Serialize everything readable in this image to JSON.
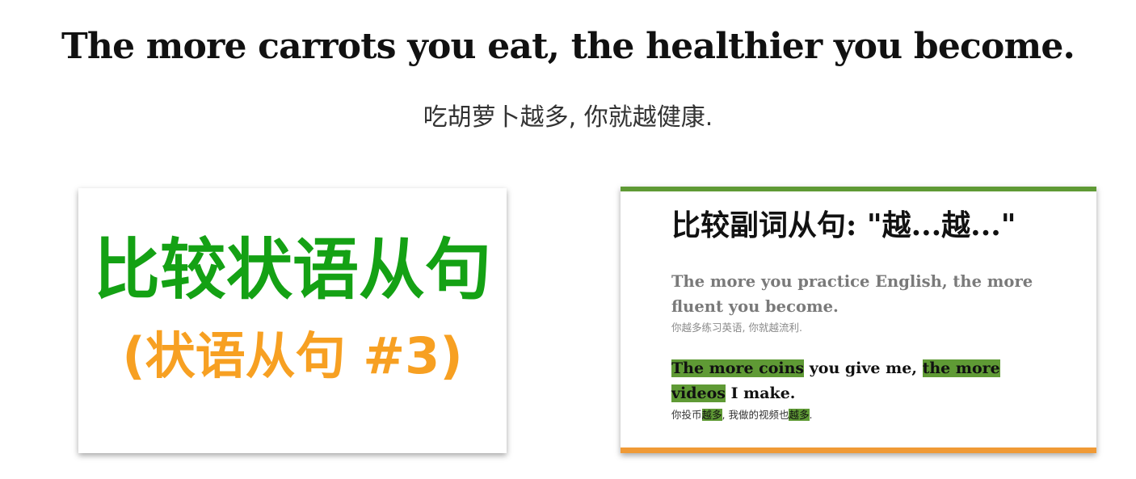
{
  "headline": {
    "en": "The more carrots you eat, the healthier you become.",
    "zh": "吃胡萝卜越多, 你就越健康."
  },
  "left_card": {
    "title": "比较状语从句",
    "subtitle": "(状语从句 #3)",
    "title_color": "#14a114",
    "subtitle_color": "#f7a022"
  },
  "right_card": {
    "title": "比较副词从句: \"越...越...\"",
    "example1": {
      "en": "The more you practice English, the more fluent you become.",
      "zh": "你越多练习英语, 你就越流利."
    },
    "example2": {
      "en_hl1": "The more coins",
      "en_mid": " you give me, ",
      "en_hl2": "the more videos",
      "en_end": " I make.",
      "zh_a": "你投币",
      "zh_hl1": "越多",
      "zh_b": ", 我做的视频也",
      "zh_hl2": "越多",
      "zh_c": "."
    },
    "accent_green": "#5f9a35",
    "accent_orange": "#f09a36"
  }
}
